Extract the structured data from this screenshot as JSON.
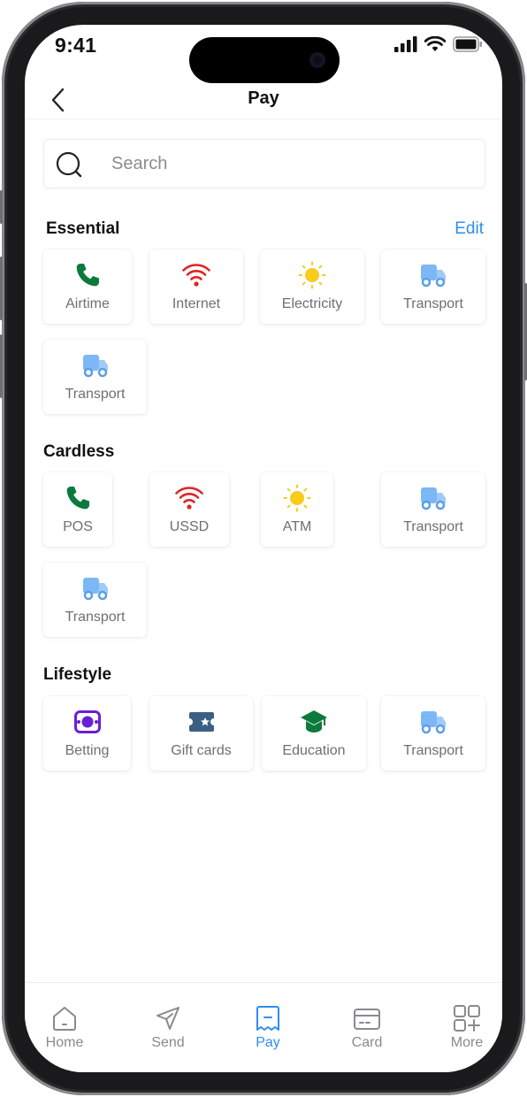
{
  "status_bar": {
    "time": "9:41"
  },
  "header": {
    "title": "Pay"
  },
  "search": {
    "placeholder": "Search"
  },
  "sections": {
    "essential": {
      "title": "Essential",
      "edit_label": "Edit",
      "items": [
        {
          "label": "Airtime",
          "icon": "phone-icon",
          "color": "#0b7a3c"
        },
        {
          "label": "Internet",
          "icon": "wifi-icon",
          "color": "#e02424"
        },
        {
          "label": "Electricity",
          "icon": "sun-icon",
          "color": "#f7cc1a"
        },
        {
          "label": "Transport",
          "icon": "truck-icon",
          "color": "#7bb8f5"
        },
        {
          "label": "Transport",
          "icon": "truck-icon",
          "color": "#7bb8f5"
        }
      ]
    },
    "cardless": {
      "title": "Cardless",
      "items": [
        {
          "label": "POS",
          "icon": "phone-icon",
          "color": "#0b7a3c"
        },
        {
          "label": "USSD",
          "icon": "wifi-icon",
          "color": "#e02424"
        },
        {
          "label": "ATM",
          "icon": "sun-icon",
          "color": "#f7cc1a"
        },
        {
          "label": "Transport",
          "icon": "truck-icon",
          "color": "#7bb8f5"
        },
        {
          "label": "Transport",
          "icon": "truck-icon",
          "color": "#7bb8f5"
        }
      ]
    },
    "lifestyle": {
      "title": "Lifestyle",
      "items": [
        {
          "label": "Betting",
          "icon": "betting-icon",
          "color": "#6a1fd6"
        },
        {
          "label": "Gift cards",
          "icon": "gift-card-icon",
          "color": "#3b5f82"
        },
        {
          "label": "Education",
          "icon": "graduation-cap-icon",
          "color": "#0b7a3c"
        },
        {
          "label": "Transport",
          "icon": "truck-icon",
          "color": "#7bb8f5"
        }
      ]
    }
  },
  "tabbar": {
    "items": [
      {
        "label": "Home",
        "icon": "home-icon"
      },
      {
        "label": "Send",
        "icon": "send-icon"
      },
      {
        "label": "Pay",
        "icon": "pay-icon",
        "active": true
      },
      {
        "label": "Card",
        "icon": "card-icon"
      },
      {
        "label": "More",
        "icon": "grid-plus-icon"
      }
    ],
    "active_color": "#2f8cf0",
    "inactive_color": "#8a8a8e"
  },
  "accent_color": "#2f8cf0"
}
